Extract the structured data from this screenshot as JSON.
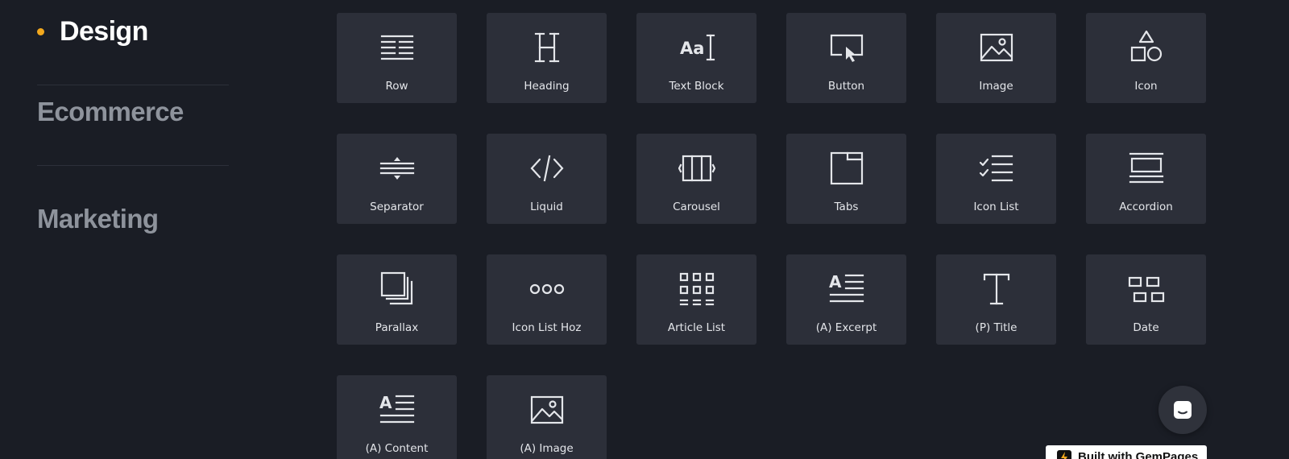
{
  "sidebar": {
    "categories": [
      {
        "label": "Design",
        "active": true
      },
      {
        "label": "Ecommerce",
        "active": false
      },
      {
        "label": "Marketing",
        "active": false
      }
    ]
  },
  "elements": [
    {
      "label": "Row",
      "icon": "row-icon"
    },
    {
      "label": "Heading",
      "icon": "heading-icon"
    },
    {
      "label": "Text Block",
      "icon": "text-block-icon"
    },
    {
      "label": "Button",
      "icon": "button-icon"
    },
    {
      "label": "Image",
      "icon": "image-icon"
    },
    {
      "label": "Icon",
      "icon": "shapes-icon"
    },
    {
      "label": "Separator",
      "icon": "separator-icon"
    },
    {
      "label": "Liquid",
      "icon": "code-icon"
    },
    {
      "label": "Carousel",
      "icon": "carousel-icon"
    },
    {
      "label": "Tabs",
      "icon": "tabs-icon"
    },
    {
      "label": "Icon List",
      "icon": "checklist-icon"
    },
    {
      "label": "Accordion",
      "icon": "accordion-icon"
    },
    {
      "label": "Parallax",
      "icon": "parallax-icon"
    },
    {
      "label": "Icon List Hoz",
      "icon": "dots-icon"
    },
    {
      "label": "Article List",
      "icon": "article-list-icon"
    },
    {
      "label": "(A) Excerpt",
      "icon": "excerpt-icon"
    },
    {
      "label": "(P) Title",
      "icon": "title-icon"
    },
    {
      "label": "Date",
      "icon": "date-icon"
    },
    {
      "label": "(A) Content",
      "icon": "content-icon"
    },
    {
      "label": "(A) Image",
      "icon": "image-icon"
    }
  ],
  "badge": {
    "label": "Built with GemPages"
  },
  "colors": {
    "background": "#1a1d25",
    "tile": "#2c2f39",
    "accent": "#f2a81d",
    "icon": "#e4e6ea"
  }
}
